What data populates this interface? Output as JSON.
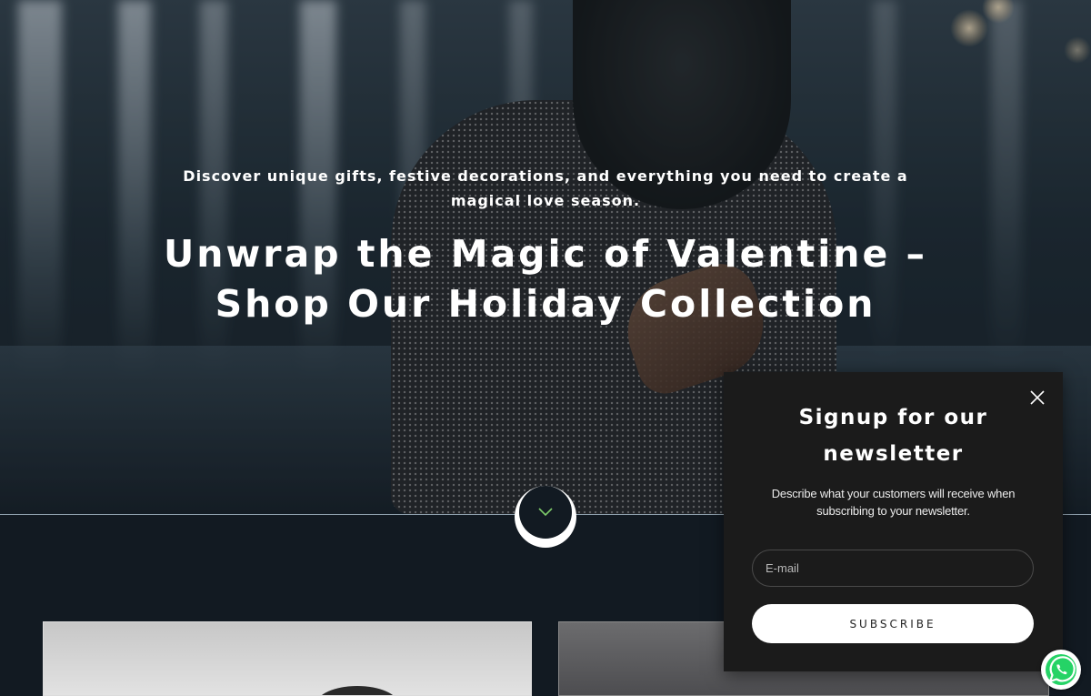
{
  "hero": {
    "subtitle": "Discover unique gifts, festive decorations, and everything you need to create a magical love season.",
    "title": "Unwrap the Magic of Valentine – Shop Our Holiday Collection"
  },
  "scroll_down": {
    "icon": "chevron-down-icon",
    "icon_color": "#7ecb6a"
  },
  "newsletter": {
    "title": "Signup for our newsletter",
    "description": "Describe what your customers will receive when subscribing to your newsletter.",
    "email_placeholder": "E-mail",
    "email_value": "",
    "subscribe_label": "SUBSCRIBE",
    "close_icon": "close-icon"
  },
  "whatsapp": {
    "icon": "whatsapp-icon",
    "color": "#25d366"
  },
  "colors": {
    "page_background": "#121a22",
    "popup_background": "#1b1b1b",
    "button_background": "#ffffff"
  }
}
